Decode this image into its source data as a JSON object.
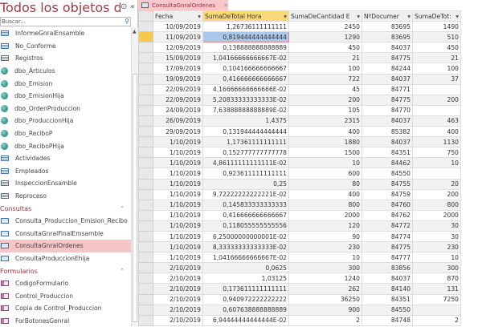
{
  "nav": {
    "title": "Todos los objetos de Ac...",
    "search_placeholder": "Buscar...",
    "items": [
      {
        "label": "InformeGnralEnsamble",
        "icon": "table"
      },
      {
        "label": "No_Conforme",
        "icon": "table"
      },
      {
        "label": "Registros",
        "icon": "table"
      },
      {
        "label": "dbo_Articulos",
        "icon": "link"
      },
      {
        "label": "dbo_Emision",
        "icon": "link"
      },
      {
        "label": "dbo_EmisionHija",
        "icon": "link"
      },
      {
        "label": "dbo_OrdenProduccion",
        "icon": "link"
      },
      {
        "label": "dbo_ProduccionHija",
        "icon": "link"
      },
      {
        "label": "dbo_ReciboP",
        "icon": "link"
      },
      {
        "label": "dbo_ReciboPHija",
        "icon": "link"
      },
      {
        "label": "Actividades",
        "icon": "table"
      },
      {
        "label": "Empleados",
        "icon": "table"
      },
      {
        "label": "InspeccionEnsamble",
        "icon": "table"
      },
      {
        "label": "Reproceso",
        "icon": "table"
      },
      {
        "group": "Consultas"
      },
      {
        "label": "Consulta_Produccion_Emision_Recibo",
        "icon": "query"
      },
      {
        "label": "ConsultaGnralFinalEmsamble",
        "icon": "query"
      },
      {
        "label": "ConsultaGnralOrdenes",
        "icon": "query",
        "selected": true
      },
      {
        "label": "ConsultaProduccionEhija",
        "icon": "query"
      },
      {
        "group": "Formularios"
      },
      {
        "label": "CodigoFormulario",
        "icon": "form"
      },
      {
        "label": "Control_Produccion",
        "icon": "form"
      },
      {
        "label": "Copia de Control_Produccion",
        "icon": "form"
      },
      {
        "label": "ForBotonesGenral",
        "icon": "form"
      }
    ]
  },
  "tab": {
    "label": "ConsultaGnralOrdenes",
    "close": "✕"
  },
  "grid": {
    "columns": [
      "Fecha",
      "SumaDeTotal Hora",
      "SumaDeCantidad E",
      "NºDocumer",
      "SumaDeTot:"
    ],
    "rows": [
      [
        "10/09/2019",
        "1,26736111111111",
        "2450",
        "83695",
        "1490"
      ],
      [
        "11/09/2019",
        "0,819444444444444",
        "1290",
        "83695",
        "510"
      ],
      [
        "12/09/2019",
        "0,138888888888889",
        "450",
        "84037",
        "450"
      ],
      [
        "15/09/2019",
        "1,04166666666667E-02",
        "21",
        "84775",
        "21"
      ],
      [
        "17/09/2019",
        "0,104166666666667",
        "100",
        "84244",
        "100"
      ],
      [
        "19/09/2019",
        "0,416666666666667",
        "722",
        "84037",
        "37"
      ],
      [
        "22/09/2019",
        "4,16666666666666E-02",
        "45",
        "84771",
        ""
      ],
      [
        "22/09/2019",
        "5,20833333333333E-02",
        "200",
        "84775",
        "200"
      ],
      [
        "24/09/2019",
        "7,63888888888889E-02",
        "105",
        "84770",
        ""
      ],
      [
        "26/09/2019",
        "1,4375",
        "2315",
        "84037",
        "463"
      ],
      [
        "29/09/2019",
        "0,131944444444444",
        "400",
        "85382",
        "400"
      ],
      [
        "1/10/2019",
        "1,17361111111111",
        "1880",
        "84037",
        "1130"
      ],
      [
        "1/10/2019",
        "0,152777777777778",
        "1500",
        "84351",
        "750"
      ],
      [
        "1/10/2019",
        "4,86111111111111E-02",
        "10",
        "84462",
        "10"
      ],
      [
        "1/10/2019",
        "0,923611111111111",
        "600",
        "84550",
        ""
      ],
      [
        "1/10/2019",
        "0,25",
        "80",
        "84755",
        "20"
      ],
      [
        "1/10/2019",
        "9,72222222222221E-02",
        "400",
        "84759",
        "200"
      ],
      [
        "1/10/2019",
        "0,145833333333333",
        "800",
        "84760",
        "800"
      ],
      [
        "1/10/2019",
        "0,416666666666667",
        "2000",
        "84762",
        "2000"
      ],
      [
        "1/10/2019",
        "0,118055555555556",
        "120",
        "84772",
        "30"
      ],
      [
        "1/10/2019",
        "6,25000000000001E-02",
        "90",
        "84774",
        "30"
      ],
      [
        "1/10/2019",
        "8,33333333333333E-02",
        "230",
        "84775",
        "230"
      ],
      [
        "1/10/2019",
        "1,04166666666667E-02",
        "10",
        "84777",
        "10"
      ],
      [
        "2/10/2019",
        "0,0625",
        "300",
        "83856",
        "300"
      ],
      [
        "2/10/2019",
        "1,03125",
        "1240",
        "84037",
        "870"
      ],
      [
        "2/10/2019",
        "0,173611111111111",
        "262",
        "84140",
        "131"
      ],
      [
        "2/10/2019",
        "0,940972222222222",
        "36250",
        "84351",
        "7250"
      ],
      [
        "2/10/2019",
        "0,607638888888889",
        "900",
        "84550",
        ""
      ],
      [
        "2/10/2019",
        "6,94444444444444E-02",
        "2",
        "84748",
        "2"
      ]
    ]
  }
}
